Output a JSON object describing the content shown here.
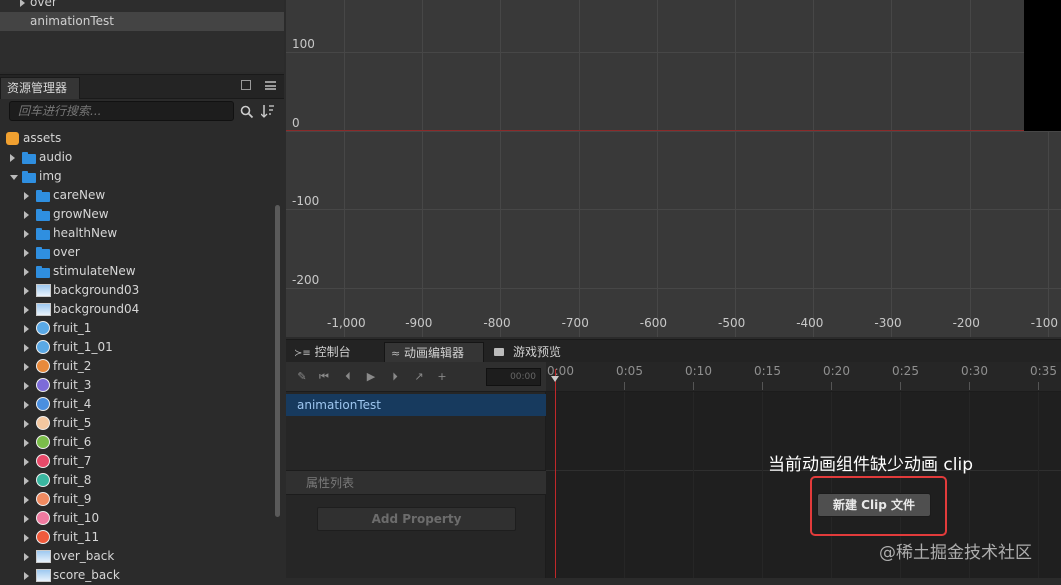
{
  "hierarchy": {
    "items": [
      {
        "label": "over"
      },
      {
        "label": "animationTest",
        "selected": true
      }
    ]
  },
  "assets_panel": {
    "tab_label": "资源管理器",
    "search_placeholder": "回车进行搜索...",
    "icons": [
      "search-icon",
      "sort-icon",
      "popout-icon",
      "menu-icon"
    ],
    "tree": [
      {
        "label": "assets",
        "type": "root"
      },
      {
        "label": "audio",
        "type": "folder"
      },
      {
        "label": "img",
        "type": "folder",
        "expanded": true
      },
      {
        "label": "careNew",
        "type": "folder"
      },
      {
        "label": "growNew",
        "type": "folder"
      },
      {
        "label": "healthNew",
        "type": "folder"
      },
      {
        "label": "over",
        "type": "folder"
      },
      {
        "label": "stimulateNew",
        "type": "folder"
      },
      {
        "label": "background03",
        "type": "image"
      },
      {
        "label": "background04",
        "type": "image"
      },
      {
        "label": "fruit_1",
        "type": "sprite",
        "color": "#5aa9e6"
      },
      {
        "label": "fruit_1_01",
        "type": "sprite",
        "color": "#5aa9e6"
      },
      {
        "label": "fruit_2",
        "type": "sprite",
        "color": "#e88a3c"
      },
      {
        "label": "fruit_3",
        "type": "sprite",
        "color": "#7c6bd8"
      },
      {
        "label": "fruit_4",
        "type": "sprite",
        "color": "#4a8fe0"
      },
      {
        "label": "fruit_5",
        "type": "sprite",
        "color": "#f3c7a0"
      },
      {
        "label": "fruit_6",
        "type": "sprite",
        "color": "#7bbd4a"
      },
      {
        "label": "fruit_7",
        "type": "sprite",
        "color": "#e84a6a"
      },
      {
        "label": "fruit_8",
        "type": "sprite",
        "color": "#3ab7a0"
      },
      {
        "label": "fruit_9",
        "type": "sprite",
        "color": "#f08a60"
      },
      {
        "label": "fruit_10",
        "type": "sprite",
        "color": "#f07aa0"
      },
      {
        "label": "fruit_11",
        "type": "sprite",
        "color": "#f05a3c"
      },
      {
        "label": "over_back",
        "type": "image"
      },
      {
        "label": "score_back",
        "type": "image"
      }
    ]
  },
  "scene": {
    "y_labels": [
      "100",
      "0",
      "-100",
      "-200"
    ],
    "x_labels": [
      "-1,000",
      "-900",
      "-800",
      "-700",
      "-600",
      "-500",
      "-400",
      "-300",
      "-200",
      "-100"
    ],
    "axis_color": "#8a2a2a"
  },
  "dock": {
    "tabs": [
      {
        "label": "控制台",
        "icon": "console-icon"
      },
      {
        "label": "动画编辑器",
        "icon": "animation-icon",
        "active": true
      },
      {
        "label": "游戏预览",
        "icon": "camera-icon"
      }
    ]
  },
  "animation_editor": {
    "toolbar_icons": [
      "edit-icon",
      "rewind-icon",
      "prev-frame-icon",
      "play-icon",
      "next-frame-icon",
      "add-event-icon",
      "add-keyframe-icon"
    ],
    "time_value": "00:00",
    "ruler_ticks": [
      "0:00",
      "0:05",
      "0:10",
      "0:15",
      "0:20",
      "0:25",
      "0:30",
      "0:35"
    ],
    "node": "animationTest",
    "property_list_label": "属性列表",
    "add_property_label": "Add Property",
    "missing_clip_text": "当前动画组件缺少动画 clip",
    "new_clip_label": "新建 Clip 文件",
    "accent_color": "#e23b3b"
  },
  "watermark": "@稀土掘金技术社区"
}
